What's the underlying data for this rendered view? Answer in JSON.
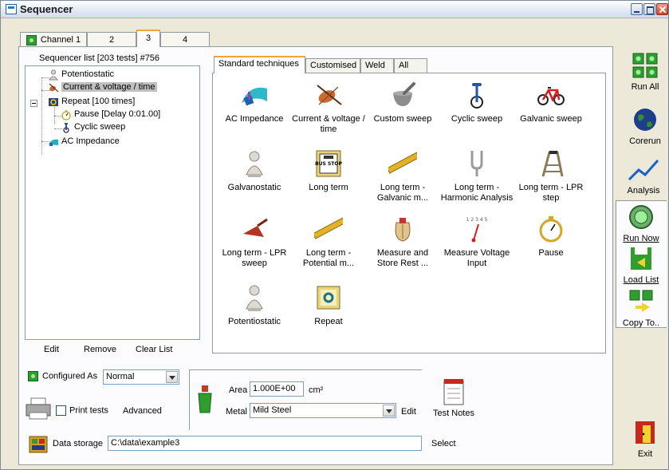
{
  "window": {
    "title": "Sequencer"
  },
  "channel_tabs": [
    {
      "label": "Channel 1",
      "has_led": true
    },
    {
      "label": "2"
    },
    {
      "label": "3",
      "active": true
    },
    {
      "label": "4"
    }
  ],
  "sequencer": {
    "header": "Sequencer list [203 tests] #756",
    "items": [
      {
        "label": "Potentiostatic",
        "icon": "bust-icon"
      },
      {
        "label": "Current & voltage / time",
        "icon": "violin-icon",
        "selected": true
      },
      {
        "label": "Repeat [100 times]",
        "icon": "repeat-icon"
      },
      {
        "label": "Pause [Delay 0:01.00]",
        "icon": "stopwatch-icon"
      },
      {
        "label": "Cyclic sweep",
        "icon": "unicycle-icon"
      },
      {
        "label": "AC Impedance",
        "icon": "wave-icon"
      }
    ],
    "actions": {
      "edit": "Edit",
      "remove": "Remove",
      "clear": "Clear List"
    }
  },
  "technique_tabs": [
    "Standard techniques",
    "Customised",
    "Weld",
    "All"
  ],
  "techniques": [
    {
      "label": "AC Impedance",
      "icon": "wave-icon"
    },
    {
      "label": "Current & voltage / time",
      "icon": "violin-icon"
    },
    {
      "label": "Custom sweep",
      "icon": "mortar-icon"
    },
    {
      "label": "Cyclic sweep",
      "icon": "unicycle-icon"
    },
    {
      "label": "Galvanic sweep",
      "icon": "bicycle-icon"
    },
    {
      "label": "Galvanostatic",
      "icon": "bust-icon"
    },
    {
      "label": "Long term",
      "icon": "bus-stop-icon"
    },
    {
      "label": "Long term - Galvanic m...",
      "icon": "ruler-icon"
    },
    {
      "label": "Long term - Harmonic Analysis",
      "icon": "tuning-fork-icon"
    },
    {
      "label": "Long term - LPR step",
      "icon": "step-ladder-icon"
    },
    {
      "label": "Long term - LPR sweep",
      "icon": "dustpan-icon"
    },
    {
      "label": "Long term - Potential m...",
      "icon": "ruler-icon"
    },
    {
      "label": "Measure and Store Rest ...",
      "icon": "sack-icon"
    },
    {
      "label": "Measure Voltage Input",
      "icon": "gauge-icon"
    },
    {
      "label": "Pause",
      "icon": "stopwatch-icon"
    },
    {
      "label": "Potentiostatic",
      "icon": "bust-icon"
    },
    {
      "label": "Repeat",
      "icon": "repeat-icon"
    }
  ],
  "gauge_ticks": "1 2 3 4 5",
  "bus_stop_sign": "BUS STOP",
  "sidebar": {
    "run_all": "Run All",
    "corerun": "Corerun",
    "analysis": "Analysis",
    "run_now": "Run Now",
    "load_list": "Load List",
    "copy_to": "Copy To..",
    "exit": "Exit"
  },
  "bottom": {
    "configured_as_label": "Configured As",
    "configured_as_value": "Normal",
    "print_tests": "Print tests",
    "advanced": "Advanced",
    "area_label": "Area",
    "area_value": "1.000E+00",
    "area_unit": "cm²",
    "metal_label": "Metal",
    "metal_value": "Mild Steel",
    "edit": "Edit",
    "test_notes": "Test Notes",
    "data_storage_label": "Data storage",
    "data_storage_value": "C:\\data\\example3",
    "select": "Select"
  },
  "colors": {
    "tab_accent": "#f0a43c",
    "led_green": "#2f9e2f",
    "selection": "#c0c0c0"
  }
}
